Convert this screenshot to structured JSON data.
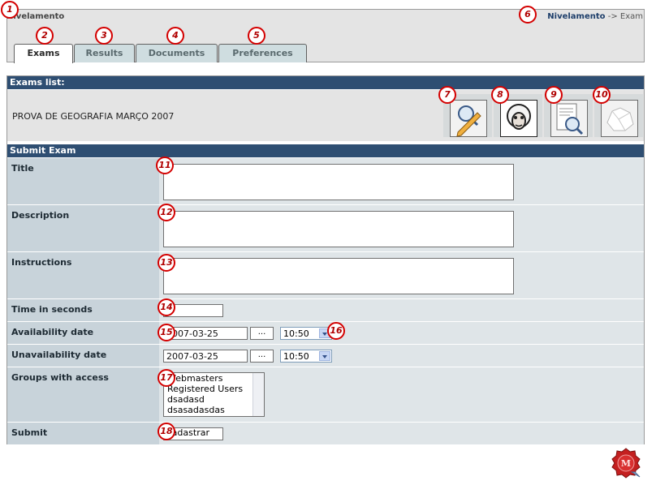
{
  "app": {
    "name": "Nivelamento"
  },
  "breadcrumb": {
    "link": "Nivelamento",
    "separator": " -> ",
    "current": "Exam"
  },
  "tabs": [
    {
      "label": "Exams",
      "active": true
    },
    {
      "label": "Results",
      "active": false
    },
    {
      "label": "Documents",
      "active": false
    },
    {
      "label": "Preferences",
      "active": false
    }
  ],
  "exams_list": {
    "header": "Exams list:",
    "exam_title": "PROVA DE GEOGRAFIA MARÇO 2007",
    "actions": [
      {
        "name": "view-edit-icon"
      },
      {
        "name": "sheep-icon"
      },
      {
        "name": "document-search-icon"
      },
      {
        "name": "crumpled-paper-icon"
      }
    ]
  },
  "submit_form": {
    "header": "Submit Exam",
    "title_label": "Title",
    "description_label": "Description",
    "instructions_label": "Instructions",
    "time_label": "Time in seconds",
    "availability_label": "Availability date",
    "availability_date": "2007-03-25",
    "availability_time": "10:50",
    "unavailability_label": "Unavailability date",
    "unavailability_date": "2007-03-25",
    "unavailability_time": "10:50",
    "date_picker_label": "...",
    "groups_label": "Groups with access",
    "groups": [
      "Webmasters",
      "Registered Users",
      "dsadasd",
      "dsasadasdas"
    ],
    "submit_label": "Submit",
    "submit_button": "Cadastrar"
  },
  "badges": [
    "1",
    "2",
    "3",
    "4",
    "5",
    "6",
    "7",
    "8",
    "9",
    "10",
    "11",
    "12",
    "13",
    "14",
    "15",
    "16",
    "17",
    "18"
  ],
  "colors": {
    "header_bg": "#2e4e72",
    "badge": "#d40000",
    "label_bg": "#c8d3da",
    "row_bg": "#dfe5e8"
  }
}
